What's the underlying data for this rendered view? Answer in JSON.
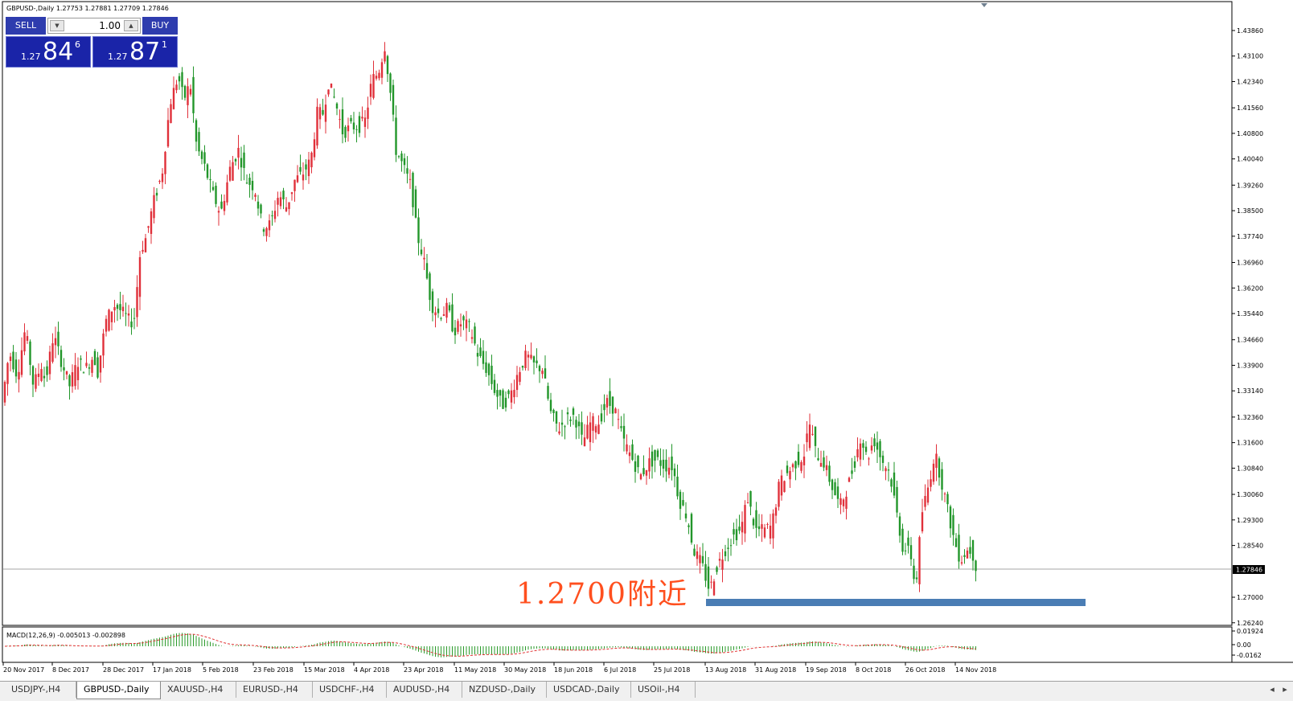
{
  "window": {
    "symbol_info": "GBPUSD-,Daily  1.27753 1.27881 1.27709 1.27846"
  },
  "trade_panel": {
    "sell_label": "SELL",
    "buy_label": "BUY",
    "lot_value": "1.00",
    "sell_price": {
      "prefix": "1.27",
      "big": "84",
      "sup": "6"
    },
    "buy_price": {
      "prefix": "1.27",
      "big": "87",
      "sup": "1"
    }
  },
  "annotation": {
    "text": "1.2700附近",
    "color": "#ff4f1e",
    "band_color": "#4a7db4"
  },
  "indicator": {
    "label": "MACD(12,26,9) -0.005013 -0.002898",
    "ticks": [
      "0.01924",
      "0.00",
      "-0.0162"
    ]
  },
  "price_axis": {
    "ticks": [
      "1.43860",
      "1.43100",
      "1.42340",
      "1.41560",
      "1.40800",
      "1.40040",
      "1.39260",
      "1.38500",
      "1.37740",
      "1.36960",
      "1.36200",
      "1.35440",
      "1.34660",
      "1.33900",
      "1.33140",
      "1.32360",
      "1.31600",
      "1.30840",
      "1.30060",
      "1.29300",
      "1.28540",
      "1.27000",
      "1.26240"
    ],
    "current": "1.27846"
  },
  "date_axis": [
    "20 Nov 2017",
    "8 Dec 2017",
    "28 Dec 2017",
    "17 Jan 2018",
    "5 Feb 2018",
    "23 Feb 2018",
    "15 Mar 2018",
    "4 Apr 2018",
    "23 Apr 2018",
    "11 May 2018",
    "30 May 2018",
    "18 Jun 2018",
    "6 Jul 2018",
    "25 Jul 2018",
    "13 Aug 2018",
    "31 Aug 2018",
    "19 Sep 2018",
    "8 Oct 2018",
    "26 Oct 2018",
    "14 Nov 2018"
  ],
  "tabs": [
    "USDJPY-,H4",
    "GBPUSD-,Daily",
    "XAUUSD-,H4",
    "EURUSD-,H4",
    "USDCHF-,H4",
    "AUDUSD-,H4",
    "NZDUSD-,Daily",
    "USDCAD-,Daily",
    "USOil-,H4"
  ],
  "active_tab": 1,
  "colors": {
    "bull": "#e0303a",
    "bear": "#22962a",
    "macd_bar": "#2a9a2a",
    "signal": "#e03030"
  },
  "price_path": [
    [
      0,
      1.318
    ],
    [
      15,
      1.343
    ],
    [
      25,
      1.336
    ],
    [
      35,
      1.35
    ],
    [
      45,
      1.333
    ],
    [
      55,
      1.339
    ],
    [
      60,
      1.334
    ],
    [
      70,
      1.348
    ],
    [
      80,
      1.34
    ],
    [
      90,
      1.333
    ],
    [
      100,
      1.34
    ],
    [
      110,
      1.338
    ],
    [
      120,
      1.342
    ],
    [
      125,
      1.337
    ],
    [
      135,
      1.352
    ],
    [
      145,
      1.357
    ],
    [
      155,
      1.355
    ],
    [
      165,
      1.352
    ],
    [
      170,
      1.352
    ],
    [
      178,
      1.373
    ],
    [
      185,
      1.377
    ],
    [
      195,
      1.388
    ],
    [
      205,
      1.396
    ],
    [
      215,
      1.417
    ],
    [
      225,
      1.425
    ],
    [
      232,
      1.418
    ],
    [
      240,
      1.423
    ],
    [
      248,
      1.404
    ],
    [
      258,
      1.398
    ],
    [
      268,
      1.39
    ],
    [
      278,
      1.384
    ],
    [
      290,
      1.398
    ],
    [
      300,
      1.403
    ],
    [
      310,
      1.394
    ],
    [
      320,
      1.392
    ],
    [
      330,
      1.38
    ],
    [
      340,
      1.381
    ],
    [
      350,
      1.39
    ],
    [
      360,
      1.386
    ],
    [
      370,
      1.394
    ],
    [
      380,
      1.396
    ],
    [
      390,
      1.4
    ],
    [
      398,
      1.414
    ],
    [
      405,
      1.414
    ],
    [
      412,
      1.423
    ],
    [
      420,
      1.418
    ],
    [
      430,
      1.408
    ],
    [
      440,
      1.41
    ],
    [
      450,
      1.41
    ],
    [
      458,
      1.412
    ],
    [
      466,
      1.424
    ],
    [
      474,
      1.426
    ],
    [
      482,
      1.434
    ],
    [
      490,
      1.418
    ],
    [
      496,
      1.403
    ],
    [
      505,
      1.398
    ],
    [
      515,
      1.392
    ],
    [
      522,
      1.378
    ],
    [
      530,
      1.371
    ],
    [
      540,
      1.357
    ],
    [
      550,
      1.354
    ],
    [
      560,
      1.356
    ],
    [
      568,
      1.349
    ],
    [
      578,
      1.352
    ],
    [
      588,
      1.35
    ],
    [
      598,
      1.342
    ],
    [
      608,
      1.338
    ],
    [
      618,
      1.332
    ],
    [
      628,
      1.327
    ],
    [
      638,
      1.33
    ],
    [
      648,
      1.337
    ],
    [
      658,
      1.342
    ],
    [
      668,
      1.339
    ],
    [
      678,
      1.338
    ],
    [
      688,
      1.325
    ],
    [
      698,
      1.32
    ],
    [
      708,
      1.323
    ],
    [
      718,
      1.324
    ],
    [
      728,
      1.316
    ],
    [
      738,
      1.322
    ],
    [
      748,
      1.322
    ],
    [
      758,
      1.328
    ],
    [
      768,
      1.326
    ],
    [
      778,
      1.317
    ],
    [
      790,
      1.311
    ],
    [
      800,
      1.306
    ],
    [
      810,
      1.31
    ],
    [
      820,
      1.311
    ],
    [
      830,
      1.309
    ],
    [
      840,
      1.309
    ],
    [
      848,
      1.299
    ],
    [
      858,
      1.294
    ],
    [
      866,
      1.284
    ],
    [
      876,
      1.28
    ],
    [
      886,
      1.272
    ],
    [
      895,
      1.279
    ],
    [
      905,
      1.284
    ],
    [
      915,
      1.288
    ],
    [
      925,
      1.29
    ],
    [
      933,
      1.3
    ],
    [
      943,
      1.29
    ],
    [
      953,
      1.29
    ],
    [
      963,
      1.291
    ],
    [
      973,
      1.304
    ],
    [
      983,
      1.307
    ],
    [
      993,
      1.31
    ],
    [
      1003,
      1.312
    ],
    [
      1010,
      1.322
    ],
    [
      1018,
      1.313
    ],
    [
      1028,
      1.31
    ],
    [
      1038,
      1.303
    ],
    [
      1048,
      1.297
    ],
    [
      1058,
      1.303
    ],
    [
      1066,
      1.31
    ],
    [
      1074,
      1.318
    ],
    [
      1082,
      1.311
    ],
    [
      1090,
      1.317
    ],
    [
      1100,
      1.311
    ],
    [
      1110,
      1.307
    ],
    [
      1118,
      1.296
    ],
    [
      1126,
      1.285
    ],
    [
      1136,
      1.283
    ],
    [
      1142,
      1.272
    ],
    [
      1150,
      1.295
    ],
    [
      1158,
      1.303
    ],
    [
      1166,
      1.313
    ],
    [
      1174,
      1.305
    ],
    [
      1182,
      1.296
    ],
    [
      1190,
      1.287
    ],
    [
      1198,
      1.281
    ],
    [
      1206,
      1.284
    ],
    [
      1212,
      1.284
    ],
    [
      1218,
      1.2785
    ]
  ]
}
